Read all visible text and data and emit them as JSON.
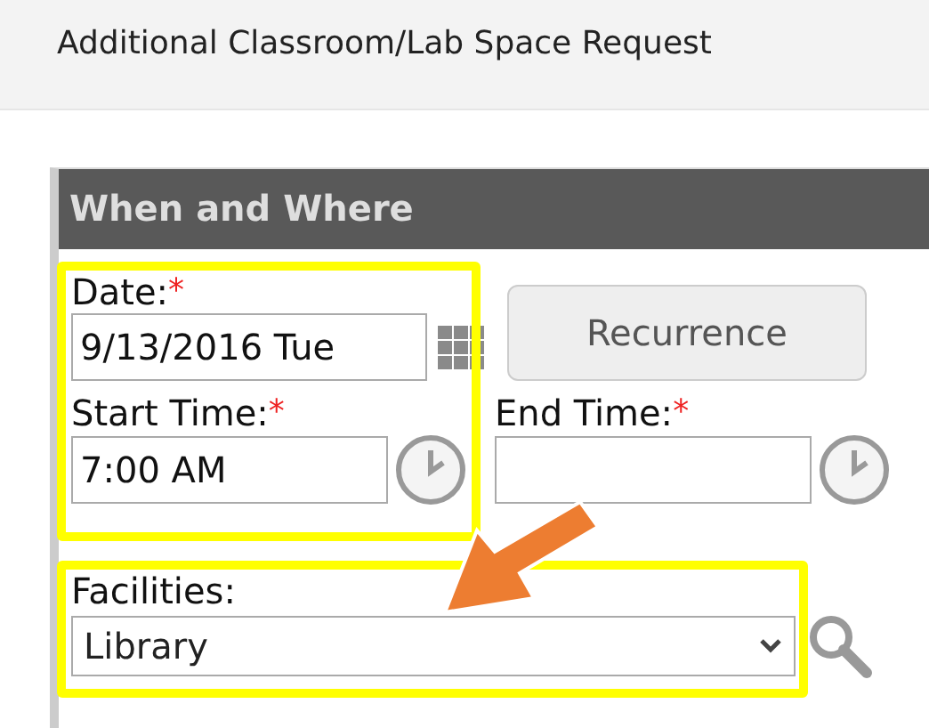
{
  "page_title": "Additional Classroom/Lab Space Request",
  "panel": {
    "header": "When and Where",
    "date": {
      "label": "Date:",
      "required_mark": "*",
      "value": "9/13/2016 Tue"
    },
    "recurrence_button": "Recurrence",
    "start_time": {
      "label": "Start Time:",
      "required_mark": "*",
      "value": "7:00 AM"
    },
    "end_time": {
      "label": "End Time:",
      "required_mark": "*"
    },
    "facilities": {
      "label": "Facilities:",
      "value": "Library"
    }
  }
}
